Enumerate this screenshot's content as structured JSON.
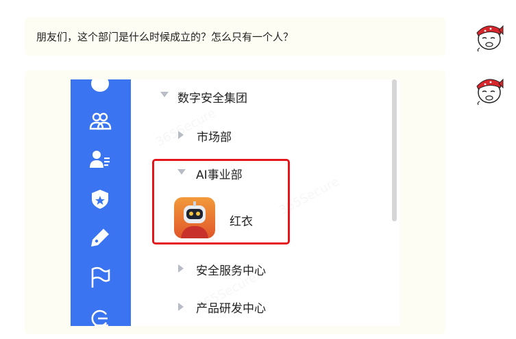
{
  "chat": {
    "messages": [
      {
        "text": "朋友们，这个部门是什么时候成立的？怎么只有一个人？"
      }
    ],
    "sender_avatar": "cartoon-face-red-bandana"
  },
  "screenshot": {
    "sidebar_icons": [
      "avatar-icon",
      "group-icon",
      "contacts-icon",
      "shield-star-icon",
      "pen-icon",
      "flag-icon",
      "cloud-g-icon"
    ],
    "tree": {
      "root": "数字安全集团",
      "items": [
        {
          "label": "市场部",
          "expanded": false
        },
        {
          "label": "AI事业部",
          "expanded": true,
          "members": [
            {
              "name": "红衣"
            }
          ]
        },
        {
          "label": "安全服务中心",
          "expanded": false
        },
        {
          "label": "产品研发中心",
          "expanded": false
        }
      ]
    },
    "highlight_color": "#e4151b",
    "sidebar_color": "#3a74f0"
  }
}
